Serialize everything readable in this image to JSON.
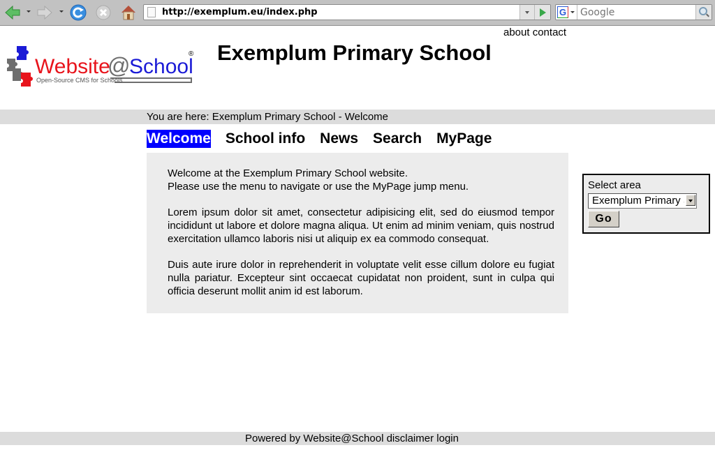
{
  "browser": {
    "url": "http://exemplum.eu/index.php",
    "search_placeholder": "Google",
    "search_engine_letter": "G",
    "icons": [
      "back-icon",
      "forward-icon",
      "reload-icon",
      "stop-icon",
      "home-icon"
    ]
  },
  "header": {
    "top_links": [
      "about",
      "contact"
    ],
    "site_title": "Exemplum Primary School",
    "logo": {
      "brand_left": "Website",
      "brand_at": "@",
      "brand_right": "School",
      "tagline": "Open-Source CMS for Schools",
      "registered": "®"
    }
  },
  "breadcrumb": {
    "prefix": "You are here:",
    "items": [
      "Exemplum Primary School",
      "Welcome"
    ],
    "separator": "-"
  },
  "menu": {
    "items": [
      {
        "label": "Welcome",
        "active": true
      },
      {
        "label": "School info",
        "active": false
      },
      {
        "label": "News",
        "active": false
      },
      {
        "label": "Search",
        "active": false
      },
      {
        "label": "MyPage",
        "active": false
      }
    ]
  },
  "content": {
    "intro_line1": "Welcome at the Exemplum Primary School website.",
    "intro_line2": "Please use the menu to navigate or use the MyPage jump menu.",
    "paragraph1": "Lorem ipsum dolor sit amet, consectetur adipisicing elit, sed do eiusmod tempor incididunt ut labore et dolore magna aliqua. Ut enim ad minim veniam, quis nostrud exercitation ullamco laboris nisi ut aliquip ex ea commodo consequat.",
    "paragraph2": "Duis aute irure dolor in reprehenderit in voluptate velit esse cillum dolore eu fugiat nulla pariatur. Excepteur sint occaecat cupidatat non proident, sunt in culpa qui officia deserunt mollit anim id est laborum."
  },
  "area_selector": {
    "label": "Select area",
    "selected": "Exemplum Primary School",
    "go_label": "Go"
  },
  "footer": {
    "powered_prefix": "Powered by",
    "powered_link": "Website@School",
    "links": [
      "disclaimer",
      "login"
    ]
  },
  "colors": {
    "active_menu_bg": "#0000ff",
    "bar_bg": "#dcdcdc",
    "content_bg": "#ececec",
    "logo_red": "#e8141c",
    "logo_blue": "#1b1bd6"
  }
}
